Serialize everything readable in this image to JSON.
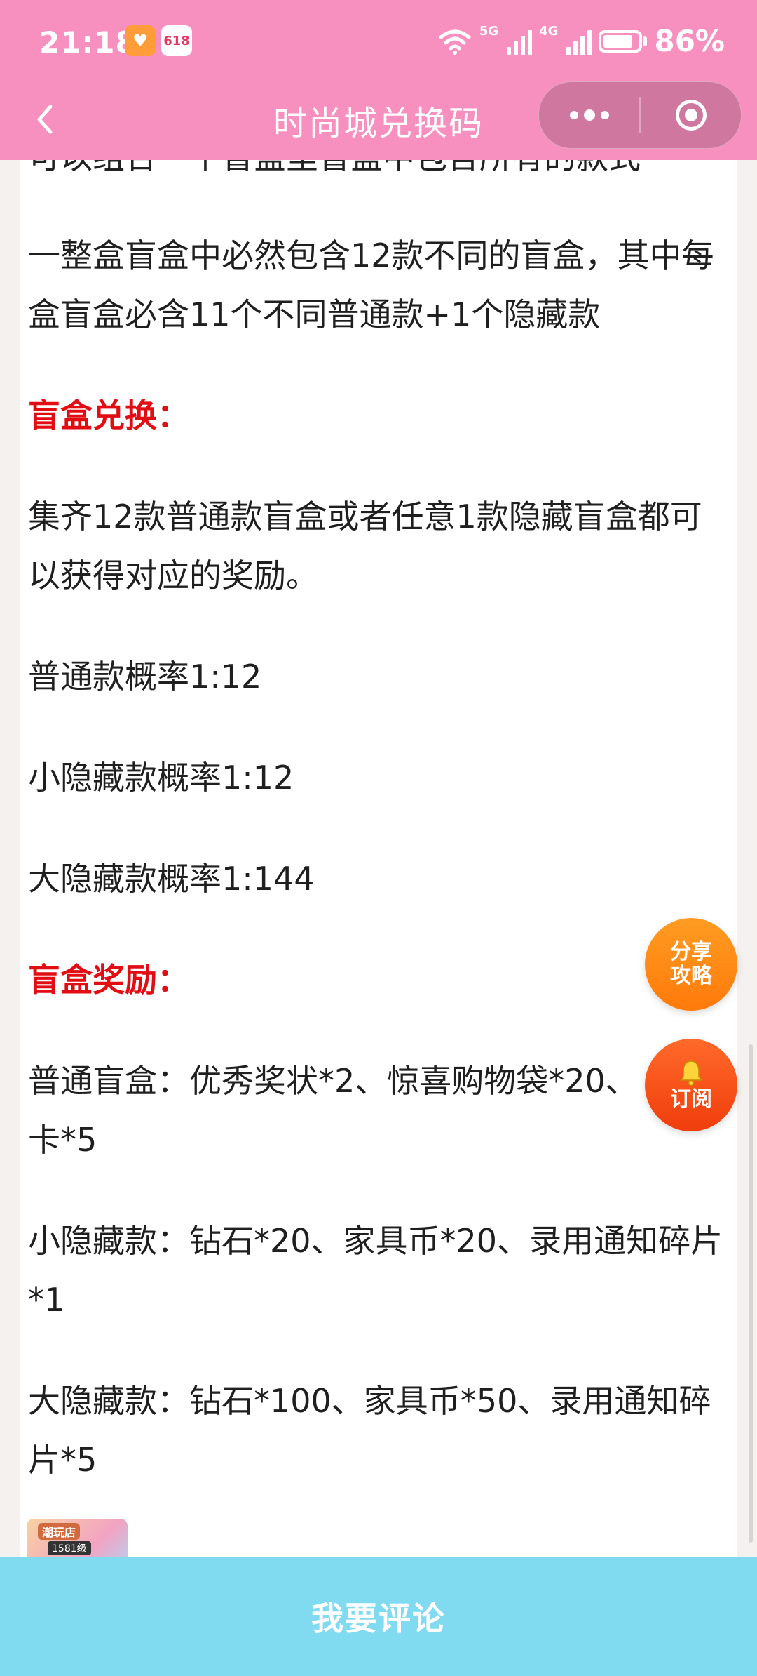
{
  "status_bar": {
    "time": "21:18",
    "network_5g": "5G",
    "network_4g": "4G",
    "battery_percent_text": "86%",
    "battery_level": 0.86,
    "badge_618": "618"
  },
  "nav": {
    "title": "时尚城兑换码",
    "back_icon": "chevron-left-icon",
    "more_icon": "more-dots-icon",
    "close_icon": "target-circle-icon"
  },
  "article": {
    "cut_line": "可以组合一个盲盒里盲盒中包含所有的款式",
    "paragraphs": [
      "一整盒盲盒中必然包含12款不同的盲盒，其中每盒盲盒必含11个不同普通款+1个隐藏款",
      "盲盒兑换：",
      "集齐12款普通款盲盒或者任意1款隐藏盲盒都可以获得对应的奖励。",
      "普通款概率1:12",
      "小隐藏款概率1:12",
      "大隐藏款概率1:144",
      "盲盒奖励：",
      "普通盲盒：优秀奖状*2、惊喜购物袋*20、",
      "卡*5",
      "小隐藏款：钻石*20、家具币*20、录用通知碎片*1",
      "大隐藏款：钻石*100、家具币*50、录用通知碎片*5"
    ],
    "thumbnail": {
      "label1": "潮玩店",
      "label2": "1581级"
    }
  },
  "fab": {
    "share_line1": "分享",
    "share_line2": "攻略",
    "subscribe_label": "订阅"
  },
  "bottom": {
    "comment_label": "我要评论"
  },
  "colors": {
    "header_pink": "#f78fbf",
    "heading_red": "#e20d12",
    "comment_bar": "#80daf0",
    "fab_orange": "#ff8a14"
  }
}
